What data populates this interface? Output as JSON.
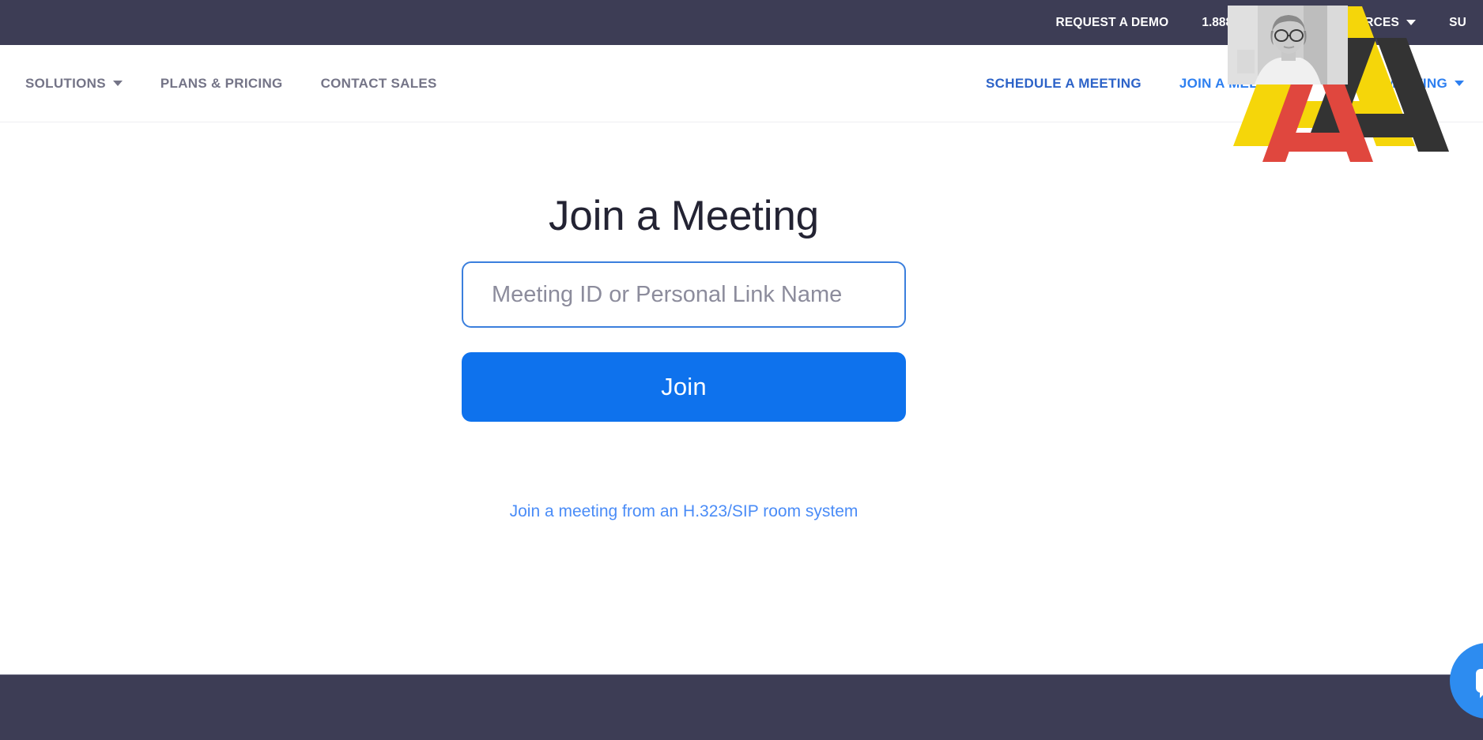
{
  "topbar": {
    "background": "#3d3d55",
    "links": [
      {
        "label": "REQUEST A DEMO",
        "name": "request-a-demo",
        "caret": false
      },
      {
        "label": "1.888.799.5926",
        "name": "phone-number",
        "caret": false
      },
      {
        "label": "RESOURCES",
        "name": "resources",
        "caret": true
      },
      {
        "label": "SU",
        "name": "support",
        "caret": false
      }
    ]
  },
  "mainnav": {
    "left_items": [
      {
        "label": "SOLUTIONS",
        "name": "solutions",
        "caret": true
      },
      {
        "label": "PLANS & PRICING",
        "name": "plans-and-pricing",
        "caret": false
      },
      {
        "label": "CONTACT SALES",
        "name": "contact-sales",
        "caret": false
      }
    ],
    "right_items": [
      {
        "label": "SCHEDULE A MEETING",
        "name": "schedule-a-meeting",
        "caret": false
      },
      {
        "label": "JOIN A MEETING",
        "name": "join-a-meeting",
        "caret": false
      },
      {
        "label": "HOST A MEETING",
        "name": "host-a-meeting",
        "caret": true
      }
    ]
  },
  "main": {
    "title": "Join a Meeting",
    "input_placeholder": "Meeting ID or Personal Link Name",
    "input_value": "",
    "join_button_label": "Join",
    "room_system_link": "Join a meeting from an H.323/SIP room system"
  },
  "logo": {
    "name": "triple-a-logo",
    "colors": {
      "yellow": "#f5d60a",
      "red": "#e0473e",
      "black": "#333333"
    }
  },
  "chat": {
    "name": "chat-support-button",
    "color": "#2d8cf0"
  },
  "colors": {
    "topbar_bg": "#3d3d55",
    "footer_bg": "#3d3d55",
    "accent_blue": "#0e72ed",
    "nav_grey": "#747487",
    "link_blue": "#4a8cf7",
    "heading": "#232333"
  }
}
